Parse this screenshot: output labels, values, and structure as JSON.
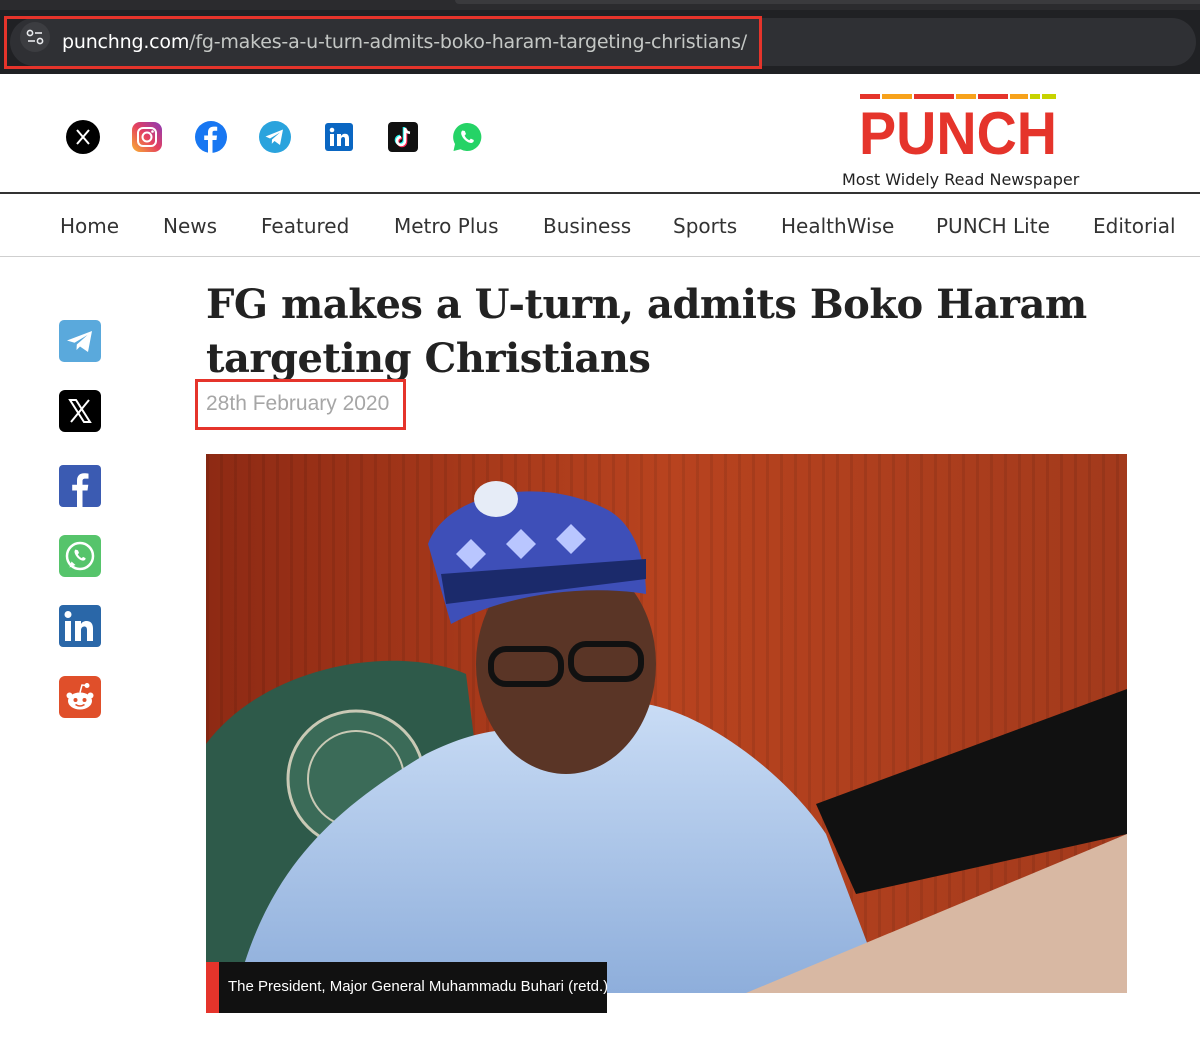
{
  "browser": {
    "url_domain": "punchng.com",
    "url_path": "/fg-makes-a-u-turn-admits-boko-haram-targeting-christians/",
    "site_info_icon": "tune-icon"
  },
  "header": {
    "social_icons": [
      "x-icon",
      "instagram-icon",
      "facebook-icon",
      "telegram-icon",
      "linkedin-icon",
      "tiktok-icon",
      "whatsapp-icon"
    ],
    "logo_text": "PUNCH",
    "tagline": "Most Widely Read Newspaper",
    "brand_color": "#e5342b"
  },
  "nav": {
    "items": [
      "Home",
      "News",
      "Featured",
      "Metro Plus",
      "Business",
      "Sports",
      "HealthWise",
      "PUNCH Lite",
      "Editorial"
    ]
  },
  "article": {
    "title": "FG makes a U-turn, admits Boko Haram targeting Christians",
    "date": "28th February 2020",
    "image_caption": "The President, Major General Muhammadu Buhari (retd.)"
  },
  "share": {
    "icons": [
      "telegram-icon",
      "x-icon",
      "facebook-icon",
      "whatsapp-icon",
      "linkedin-icon",
      "reddit-icon"
    ]
  },
  "annotations": {
    "highlight_color": "#e5342b"
  }
}
